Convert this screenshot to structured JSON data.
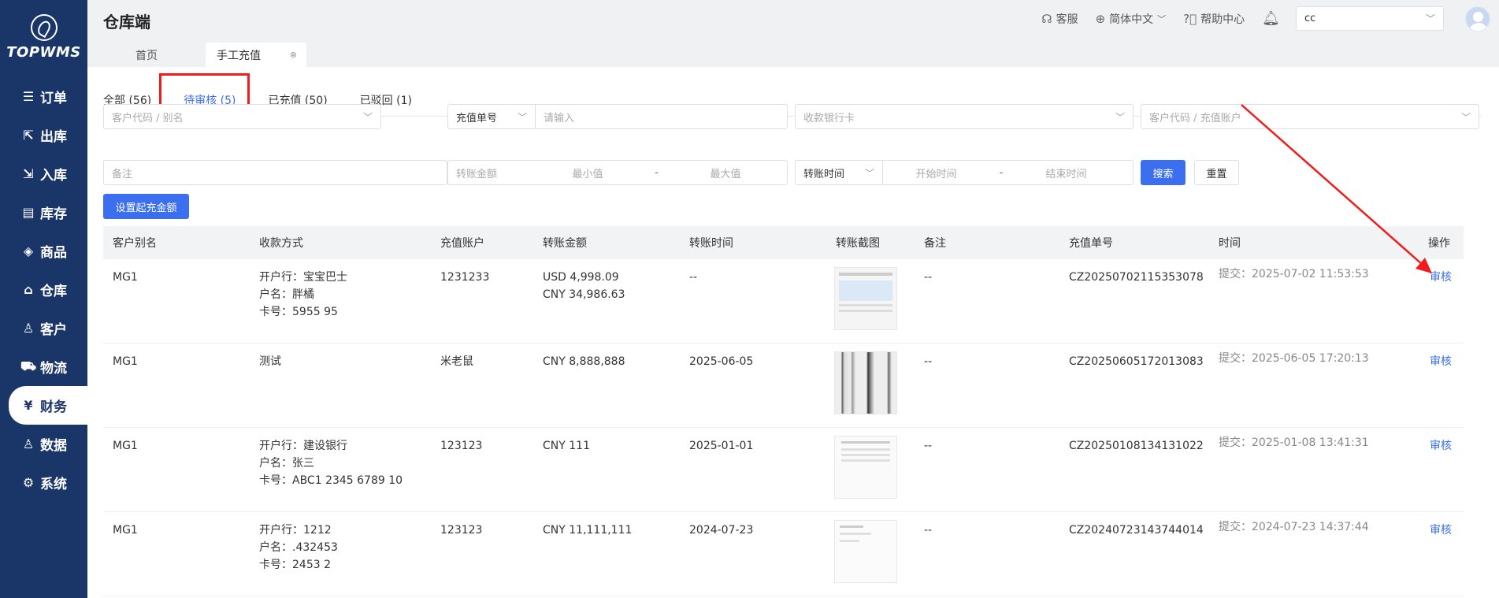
{
  "brand": {
    "logo_text": "TOPWMS",
    "app_title": "仓库端"
  },
  "sidebar": {
    "items": [
      {
        "label": "订单",
        "icon": "list-icon"
      },
      {
        "label": "出库",
        "icon": "box-out-icon"
      },
      {
        "label": "入库",
        "icon": "box-in-icon"
      },
      {
        "label": "库存",
        "icon": "inventory-icon"
      },
      {
        "label": "商品",
        "icon": "bag-icon"
      },
      {
        "label": "仓库",
        "icon": "warehouse-icon"
      },
      {
        "label": "客户",
        "icon": "user-icon"
      },
      {
        "label": "物流",
        "icon": "truck-icon"
      },
      {
        "label": "财务",
        "icon": "yen-icon",
        "active": true
      },
      {
        "label": "数据",
        "icon": "data-icon"
      },
      {
        "label": "系统",
        "icon": "gear-icon"
      }
    ]
  },
  "header": {
    "service": "客服",
    "language": "简体中文",
    "help": "帮助中心",
    "user": "cc"
  },
  "page_tabs": {
    "home": "首页",
    "current": "手工充值"
  },
  "status_tabs": [
    {
      "label": "全部 (56)"
    },
    {
      "label": "待审核 (5)",
      "active": true
    },
    {
      "label": "已充值 (50)"
    },
    {
      "label": "已驳回 (1)"
    }
  ],
  "filters": {
    "customer_alias": "客户代码 / 别名",
    "number_type": "充值单号",
    "number_input": "请输入",
    "bank_card": "收款银行卡",
    "customer_account": "客户代码 / 充值账户",
    "remark": "备注",
    "amount_label": "转账金额",
    "min": "最小值",
    "max": "最大值",
    "dash": "-",
    "time_type": "转账时间",
    "start": "开始时间",
    "end": "结束时间",
    "search": "搜索",
    "reset": "重置",
    "set_min": "设置起充金额"
  },
  "table": {
    "columns": [
      "客户别名",
      "收款方式",
      "充值账户",
      "转账金额",
      "转账时间",
      "转账截图",
      "备注",
      "充值单号",
      "时间",
      "操作"
    ],
    "rows": [
      {
        "alias": "MG1",
        "pay1": "开户行：宝宝巴士",
        "pay2": "户名：胖橘",
        "pay3": "卡号：5955 95",
        "account": "1231233",
        "amt1": "USD 4,998.09",
        "amt2": "CNY 34,986.63",
        "ttime": "--",
        "remark": "--",
        "no": "CZ20250702115353078",
        "time": "提交：2025-07-02 11:53:53",
        "op": "审核"
      },
      {
        "alias": "MG1",
        "pay1": "测试",
        "pay2": "",
        "pay3": "",
        "account": "米老鼠",
        "amt1": "CNY 8,888,888",
        "amt2": "",
        "ttime": "2025-06-05",
        "remark": "--",
        "no": "CZ20250605172013083",
        "time": "提交：2025-06-05 17:20:13",
        "op": "审核"
      },
      {
        "alias": "MG1",
        "pay1": "开户行：建设银行",
        "pay2": "户名：张三",
        "pay3": "卡号：ABC1 2345 6789 10",
        "account": "123123",
        "amt1": "CNY 111",
        "amt2": "",
        "ttime": "2025-01-01",
        "remark": "--",
        "no": "CZ20250108134131022",
        "time": "提交：2025-01-08 13:41:31",
        "op": "审核"
      },
      {
        "alias": "MG1",
        "pay1": "开户行：1212",
        "pay2": "户名：.432453",
        "pay3": "卡号：2453 2",
        "account": "123123",
        "amt1": "CNY 11,111,111",
        "amt2": "",
        "ttime": "2024-07-23",
        "remark": "--",
        "no": "CZ20240723143744014",
        "time": "提交：2024-07-23 14:37:44",
        "op": "审核"
      }
    ]
  },
  "annotation_color": "#f21b1b"
}
